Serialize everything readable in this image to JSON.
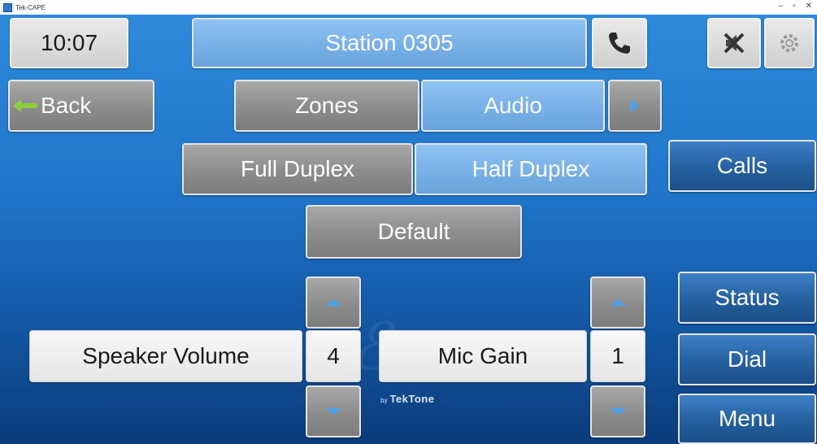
{
  "window": {
    "title": "Tek-CAPE",
    "controls": {
      "minimize": "–",
      "maximize": "▫",
      "close": "✕"
    }
  },
  "header": {
    "time": "10:07",
    "station": "Station 0305",
    "icons": [
      "phone-icon",
      "mute-icon",
      "settings-gear-icon"
    ]
  },
  "nav": {
    "back_label": "Back",
    "tabs": [
      {
        "label": "Zones",
        "active": false
      },
      {
        "label": "Audio",
        "active": true
      }
    ],
    "next_icon": "chevron-right-icon"
  },
  "duplex": {
    "options": [
      {
        "label": "Full Duplex",
        "active": false
      },
      {
        "label": "Half Duplex",
        "active": true
      }
    ]
  },
  "default_label": "Default",
  "controls": {
    "speaker_volume": {
      "label": "Speaker Volume",
      "value": "4"
    },
    "mic_gain": {
      "label": "Mic Gain",
      "value": "1"
    }
  },
  "side_menu": {
    "calls": "Calls",
    "status": "Status",
    "dial": "Dial",
    "menu": "Menu"
  },
  "logo": {
    "by": "by",
    "name": "TekTone"
  },
  "colors": {
    "background_top": "#2f8cdb",
    "background_bottom": "#0b3c7a",
    "active_tab": "#76afe6",
    "inactive_tab": "#8c8c8c",
    "side_button": "#24609f",
    "arrow": "#4aa3ea",
    "back_arrow": "#8cd13a"
  }
}
